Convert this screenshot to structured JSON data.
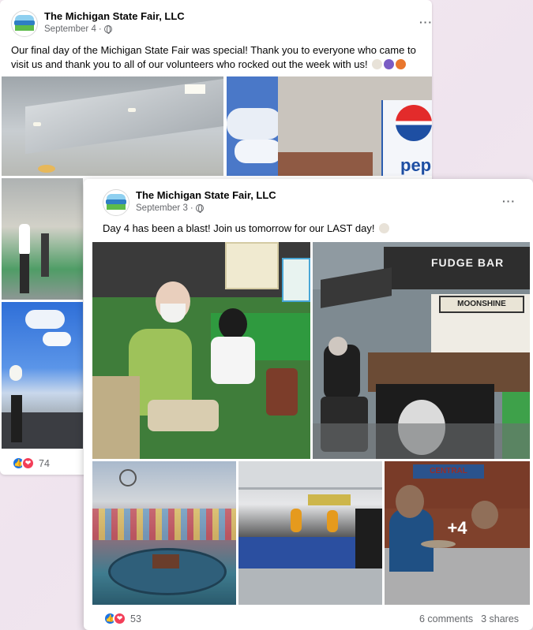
{
  "post1": {
    "page_name": "The Michigan State Fair, LLC",
    "date": "September 4",
    "separator": "·",
    "message": "Our final day of the Michigan State Fair was special! Thank you to everyone who came to visit us and thank you to all of our volunteers who rocked out the week with us!",
    "reaction_count": "74",
    "photo_text": "pep"
  },
  "post2": {
    "page_name": "The Michigan State Fair, LLC",
    "date": "September 3",
    "separator": "·",
    "message": "Day 4 has been a blast! Join us tomorrow for our LAST day!",
    "reaction_count": "53",
    "comments": "6 comments",
    "shares": "3 shares",
    "more_photos": "+4",
    "sign_fudge": "FUDGE BAR",
    "sign_moonshine": "MOONSHINE",
    "sign_central": "CENTRAL"
  },
  "menu_dots": "···",
  "colors": {
    "like": "#1b74e4",
    "love": "#f33e58",
    "secondary_text": "#65676b"
  }
}
